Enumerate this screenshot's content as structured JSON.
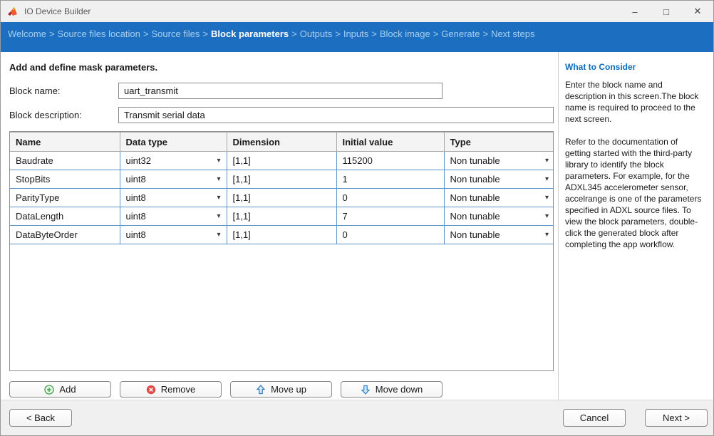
{
  "window": {
    "title": "IO Device Builder"
  },
  "icons": {
    "dropdown": "▾",
    "minimize": "–",
    "maximize": "□",
    "close": "✕"
  },
  "breadcrumb": {
    "separator": ">",
    "items": [
      {
        "label": "Welcome"
      },
      {
        "label": "Source files location"
      },
      {
        "label": "Source files"
      },
      {
        "label": "Block parameters"
      },
      {
        "label": "Outputs"
      },
      {
        "label": "Inputs"
      },
      {
        "label": "Block image"
      },
      {
        "label": "Generate"
      },
      {
        "label": "Next steps"
      }
    ],
    "active_index": 3
  },
  "main": {
    "instruction": "Add and define mask parameters.",
    "block_name": {
      "label": "Block name:",
      "value": "uart_transmit"
    },
    "block_description": {
      "label": "Block description:",
      "value": "Transmit serial data"
    },
    "table": {
      "headers": [
        "Name",
        "Data type",
        "Dimension",
        "Initial value",
        "Type"
      ],
      "rows": [
        {
          "name": "Baudrate",
          "data_type": "uint32",
          "dimension": "[1,1]",
          "initial_value": "115200",
          "type": "Non tunable"
        },
        {
          "name": "StopBits",
          "data_type": "uint8",
          "dimension": "[1,1]",
          "initial_value": "1",
          "type": "Non tunable"
        },
        {
          "name": "ParityType",
          "data_type": "uint8",
          "dimension": "[1,1]",
          "initial_value": "0",
          "type": "Non tunable"
        },
        {
          "name": "DataLength",
          "data_type": "uint8",
          "dimension": "[1,1]",
          "initial_value": "7",
          "type": "Non tunable"
        },
        {
          "name": "DataByteOrder",
          "data_type": "uint8",
          "dimension": "[1,1]",
          "initial_value": "0",
          "type": "Non tunable"
        }
      ]
    },
    "buttons": {
      "add": "Add",
      "remove": "Remove",
      "move_up": "Move up",
      "move_down": "Move down"
    }
  },
  "sidebar": {
    "title": "What to Consider",
    "paragraphs": [
      "Enter the block name and description in this screen.The block name is required to proceed to the next screen.",
      "Refer to the documentation of getting started with the third-party library to identify the block parameters. For example, for the ADXL345 accelerometer sensor, accelrange is one of the parameters specified in ADXL source files. To view the block parameters, double-click the generated block after completing the app workflow."
    ]
  },
  "footer": {
    "back": "< Back",
    "cancel": "Cancel",
    "next": "Next >"
  },
  "colors": {
    "breadcrumb_bar": "#1c6fc0",
    "breadcrumb_active": "#ffffff",
    "breadcrumb_inactive": "#a9cdee",
    "sidebar_heading": "#0b6bbd",
    "table_grid": "#5e93cc",
    "add_icon_green": "#3fa046",
    "remove_icon_red": "#e04b4b",
    "move_arrow_blue": "#2e7bbf"
  }
}
